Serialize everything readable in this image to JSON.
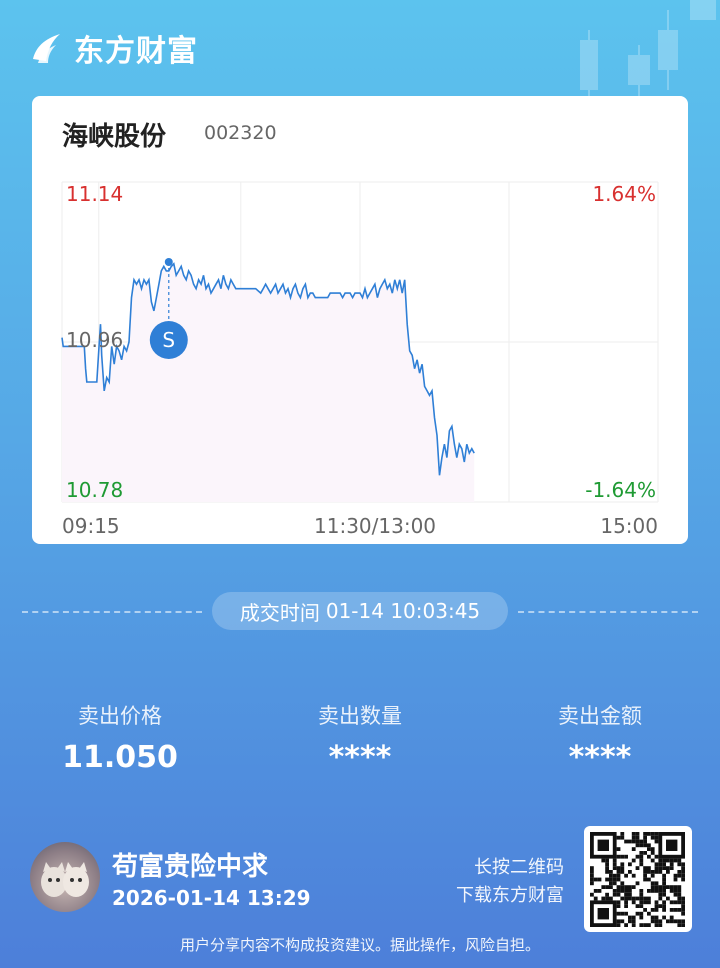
{
  "brand": {
    "name": "东方财富",
    "logo_icon": "eastmoney-logo-icon"
  },
  "stock": {
    "name": "海峡股份",
    "code": "002320"
  },
  "chart_data": {
    "type": "line",
    "y_left_ticks": {
      "high": "11.14",
      "mid": "10.96",
      "low": "10.78"
    },
    "y_right_ticks": {
      "high": "1.64%",
      "low": "-1.64%"
    },
    "x_ticks": {
      "start": "09:15",
      "mid": "11:30/13:00",
      "end": "15:00"
    },
    "ylim": [
      10.78,
      11.14
    ],
    "x_minutes_domain": [
      0,
      240
    ],
    "series": [
      {
        "values": [
          [
            0,
            10.965
          ],
          [
            0.5,
            10.955
          ],
          [
            2,
            10.955
          ],
          [
            3.5,
            10.955
          ],
          [
            5,
            10.955
          ],
          [
            7,
            10.955
          ],
          [
            9,
            10.955
          ],
          [
            9.5,
            10.93
          ],
          [
            10,
            10.915
          ],
          [
            12,
            10.915
          ],
          [
            14,
            10.915
          ],
          [
            15,
            10.96
          ],
          [
            15.5,
            10.98
          ],
          [
            16,
            10.945
          ],
          [
            17,
            10.905
          ],
          [
            18,
            10.92
          ],
          [
            19,
            10.915
          ],
          [
            20,
            10.955
          ],
          [
            21,
            10.935
          ],
          [
            22,
            10.955
          ],
          [
            23,
            10.95
          ],
          [
            24,
            10.94
          ],
          [
            25,
            10.955
          ],
          [
            26,
            10.95
          ],
          [
            27,
            10.96
          ],
          [
            28,
            11.01
          ],
          [
            29,
            11.03
          ],
          [
            30,
            11.025
          ],
          [
            31,
            11.03
          ],
          [
            32,
            11.02
          ],
          [
            33,
            11.03
          ],
          [
            34,
            11.025
          ],
          [
            35,
            11.03
          ],
          [
            36,
            11.005
          ],
          [
            37,
            10.995
          ],
          [
            38,
            11.01
          ],
          [
            39,
            11.025
          ],
          [
            40,
            11.04
          ],
          [
            41,
            11.045
          ],
          [
            42,
            11.04
          ],
          [
            43,
            11.04
          ],
          [
            44,
            11.045
          ],
          [
            45,
            11.048
          ],
          [
            46,
            11.035
          ],
          [
            47,
            11.04
          ],
          [
            48,
            11.045
          ],
          [
            49,
            11.035
          ],
          [
            50,
            11.03
          ],
          [
            51,
            11.04
          ],
          [
            52,
            11.035
          ],
          [
            53,
            11.025
          ],
          [
            54,
            11.02
          ],
          [
            55,
            11.03
          ],
          [
            56,
            11.025
          ],
          [
            57,
            11.035
          ],
          [
            58,
            11.02
          ],
          [
            59,
            11.025
          ],
          [
            60,
            11.015
          ],
          [
            61,
            11.02
          ],
          [
            62,
            11.025
          ],
          [
            63,
            11.03
          ],
          [
            64,
            11.02
          ],
          [
            65,
            11.035
          ],
          [
            66,
            11.025
          ],
          [
            67,
            11.02
          ],
          [
            68,
            11.03
          ],
          [
            69,
            11.025
          ],
          [
            70,
            11.02
          ],
          [
            72,
            11.02
          ],
          [
            74,
            11.02
          ],
          [
            76,
            11.02
          ],
          [
            78,
            11.02
          ],
          [
            80,
            11.015
          ],
          [
            81,
            11.02
          ],
          [
            82,
            11.025
          ],
          [
            83,
            11.02
          ],
          [
            84,
            11.015
          ],
          [
            85,
            11.02
          ],
          [
            86,
            11.025
          ],
          [
            87,
            11.015
          ],
          [
            88,
            11.02
          ],
          [
            89,
            11.025
          ],
          [
            90,
            11.015
          ],
          [
            91,
            11.02
          ],
          [
            92,
            11.01
          ],
          [
            93,
            11.02
          ],
          [
            94,
            11.025
          ],
          [
            95,
            11.015
          ],
          [
            96,
            11.01
          ],
          [
            97,
            11.02
          ],
          [
            98,
            11.025
          ],
          [
            99,
            11.01
          ],
          [
            100,
            11.015
          ],
          [
            101,
            11.015
          ],
          [
            102,
            11.01
          ],
          [
            103,
            11.01
          ],
          [
            104,
            11.01
          ],
          [
            105,
            11.01
          ],
          [
            106,
            11.01
          ],
          [
            107,
            11.01
          ],
          [
            108,
            11.015
          ],
          [
            109,
            11.015
          ],
          [
            110,
            11.015
          ],
          [
            111,
            11.015
          ],
          [
            112,
            11.015
          ],
          [
            113,
            11.01
          ],
          [
            114,
            11.015
          ],
          [
            115,
            11.015
          ],
          [
            116,
            11.015
          ],
          [
            117,
            11.01
          ],
          [
            118,
            11.015
          ],
          [
            119,
            11.015
          ],
          [
            120,
            11.015
          ],
          [
            121,
            11.01
          ],
          [
            122,
            11.02
          ],
          [
            123,
            11.01
          ],
          [
            124,
            11.015
          ],
          [
            125,
            11.02
          ],
          [
            126,
            11.025
          ],
          [
            127,
            11.01
          ],
          [
            128,
            11.02
          ],
          [
            129,
            11.025
          ],
          [
            130,
            11.03
          ],
          [
            131,
            11.02
          ],
          [
            132,
            11.025
          ],
          [
            133,
            11.015
          ],
          [
            134,
            11.03
          ],
          [
            135,
            11.02
          ],
          [
            136,
            11.03
          ],
          [
            137,
            11.015
          ],
          [
            138,
            11.03
          ],
          [
            139,
            10.98
          ],
          [
            140,
            10.95
          ],
          [
            141,
            10.945
          ],
          [
            142,
            10.93
          ],
          [
            143,
            10.94
          ],
          [
            144,
            10.925
          ],
          [
            145,
            10.935
          ],
          [
            146,
            10.91
          ],
          [
            147,
            10.905
          ],
          [
            148,
            10.9
          ],
          [
            149,
            10.905
          ],
          [
            150,
            10.875
          ],
          [
            151,
            10.855
          ],
          [
            152,
            10.81
          ],
          [
            153,
            10.83
          ],
          [
            154,
            10.845
          ],
          [
            155,
            10.83
          ],
          [
            156,
            10.86
          ],
          [
            157,
            10.865
          ],
          [
            158,
            10.845
          ],
          [
            159,
            10.83
          ],
          [
            160,
            10.845
          ],
          [
            161,
            10.84
          ],
          [
            162,
            10.825
          ],
          [
            163,
            10.845
          ],
          [
            164,
            10.835
          ],
          [
            165,
            10.84
          ],
          [
            166,
            10.835
          ]
        ]
      }
    ],
    "marker": {
      "label": "S",
      "x_minutes": 43,
      "price": 11.05
    },
    "colors": {
      "line": "#2f7fd6",
      "fill": "#fbf5fb",
      "up": "#d8302f",
      "down": "#1e9a33",
      "grid": "#eeeeee",
      "marker": "#2f7fd6"
    }
  },
  "trade": {
    "time_label": "成交时间",
    "time_value": "01-14 10:03:45"
  },
  "stats": [
    {
      "label": "卖出价格",
      "value": "11.050"
    },
    {
      "label": "卖出数量",
      "value": "****"
    },
    {
      "label": "卖出金额",
      "value": "****"
    }
  ],
  "user": {
    "name": "苟富贵险中求",
    "share_time": "2026-01-14 13:29"
  },
  "qr": {
    "line1": "长按二维码",
    "line2": "下载东方财富"
  },
  "disclaimer": "用户分享内容不构成投资建议。据此操作，风险自担。"
}
